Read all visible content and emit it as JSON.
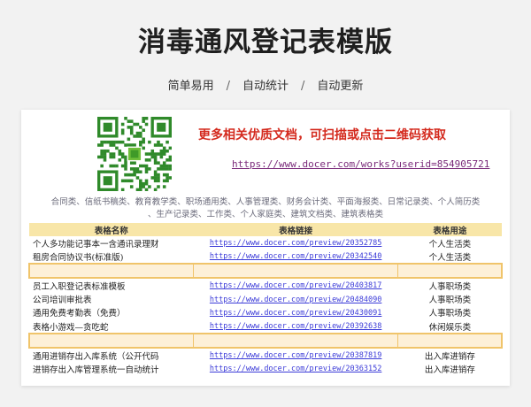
{
  "header": {
    "title": "消毒通风登记表模版",
    "features": [
      "简单易用",
      "自动统计",
      "自动更新"
    ],
    "separator": "/"
  },
  "promo": {
    "text": "更多相关优质文档，可扫描或点击二维码获取",
    "link": "https://www.docer.com/works?userid=854905721"
  },
  "categories_line1": "合同类、信纸书稿类、教育教学类、职场通用类、人事管理类、财务会计类、平面海报类、日常记录类、个人简历类",
  "categories_line2": "、生产记录类、工作类、个人家庭类、建筑文档类、建筑表格类",
  "table": {
    "headers": [
      "表格名称",
      "表格链接",
      "表格用途"
    ],
    "rows": [
      {
        "name": "个人多功能记事本一含通讯录理财",
        "link": "https://www.docer.com/preview/20352785",
        "category": "个人生活类"
      },
      {
        "name": "租房合同协议书(标准版)",
        "link": "https://www.docer.com/preview/20342540",
        "category": "个人生活类"
      },
      {
        "gap": true
      },
      {
        "name": "员工入职登记表标准模板",
        "link": "https://www.docer.com/preview/20403817",
        "category": "人事职场类"
      },
      {
        "name": "公司培训审批表",
        "link": "https://www.docer.com/preview/20484090",
        "category": "人事职场类"
      },
      {
        "name": "通用免费考勤表（免费）",
        "link": "https://www.docer.com/preview/20430091",
        "category": "人事职场类"
      },
      {
        "name": "表格小游戏—贪吃蛇",
        "link": "https://www.docer.com/preview/20392638",
        "category": "休闲娱乐类"
      },
      {
        "gap": true
      },
      {
        "name": "通用进销存出入库系统（公开代码",
        "link": "https://www.docer.com/preview/20387819",
        "category": "出入库进销存"
      },
      {
        "name": "进销存出入库管理系统一自动统计",
        "link": "https://www.docer.com/preview/20363152",
        "category": "出入库进销存"
      }
    ]
  }
}
